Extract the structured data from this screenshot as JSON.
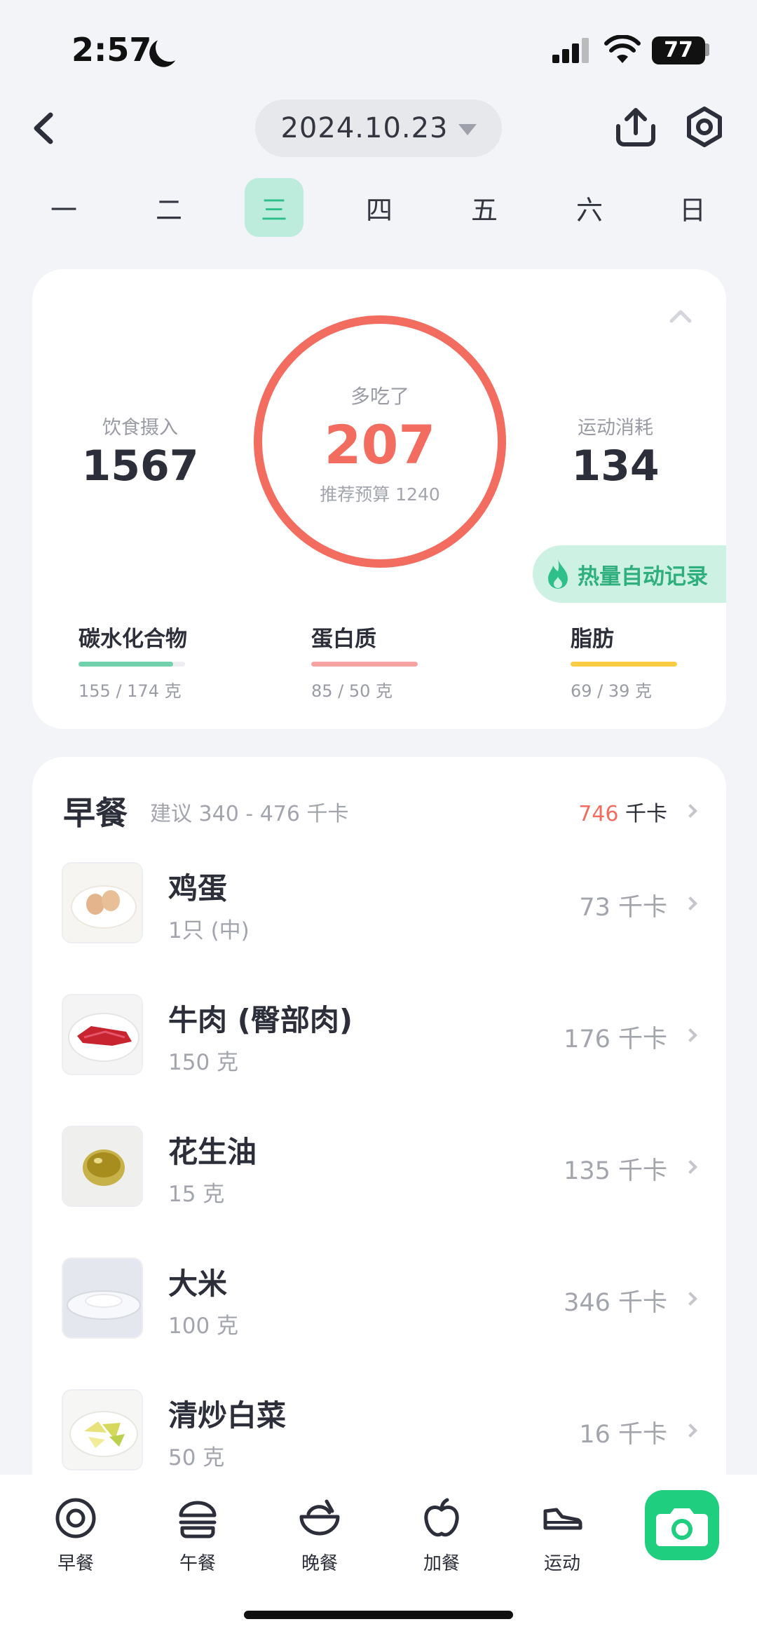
{
  "status_bar": {
    "time": "2:57",
    "battery": "77"
  },
  "header": {
    "date": "2024.10.23"
  },
  "weekdays": [
    {
      "label": "一"
    },
    {
      "label": "二"
    },
    {
      "label": "三"
    },
    {
      "label": "四"
    },
    {
      "label": "五"
    },
    {
      "label": "六"
    },
    {
      "label": "日"
    }
  ],
  "active_weekday": "三",
  "summary": {
    "intake_label": "饮食摄入",
    "intake_value": "1567",
    "exercise_label": "运动消耗",
    "exercise_value": "134",
    "ring_label": "多吃了",
    "ring_value": "207",
    "ring_budget": "推荐预算 1240",
    "auto_record": "热量自动记录",
    "macros": [
      {
        "name": "碳水化合物",
        "amount": "155 / 174 克",
        "progress": 0.89,
        "color": "#6fd2ac"
      },
      {
        "name": "蛋白质",
        "amount": "85 / 50 克",
        "progress": 1.0,
        "color": "#f6a3a3"
      },
      {
        "name": "脂肪",
        "amount": "69 / 39 克",
        "progress": 1.0,
        "color": "#f8cc45"
      }
    ]
  },
  "meal": {
    "title": "早餐",
    "suggest": "建议 340 - 476 千卡",
    "total_value": "746",
    "total_unit": " 千卡",
    "items": [
      {
        "name": "鸡蛋",
        "qty": "1只 (中)",
        "kcal": "73 千卡"
      },
      {
        "name": "牛肉 (臀部肉)",
        "qty": "150 克",
        "kcal": "176 千卡"
      },
      {
        "name": "花生油",
        "qty": "15 克",
        "kcal": "135 千卡"
      },
      {
        "name": "大米",
        "qty": "100 克",
        "kcal": "346 千卡"
      },
      {
        "name": "清炒白菜",
        "qty": "50 克",
        "kcal": "16 千卡"
      }
    ]
  },
  "tabs": [
    {
      "label": "早餐",
      "icon": "fried-egg-icon"
    },
    {
      "label": "午餐",
      "icon": "burger-icon"
    },
    {
      "label": "晚餐",
      "icon": "bowl-icon"
    },
    {
      "label": "加餐",
      "icon": "apple-icon"
    },
    {
      "label": "运动",
      "icon": "sneaker-icon"
    }
  ],
  "colors": {
    "accent": "#2fbf8a",
    "over": "#f26c5f",
    "camera": "#1fcf7f"
  }
}
